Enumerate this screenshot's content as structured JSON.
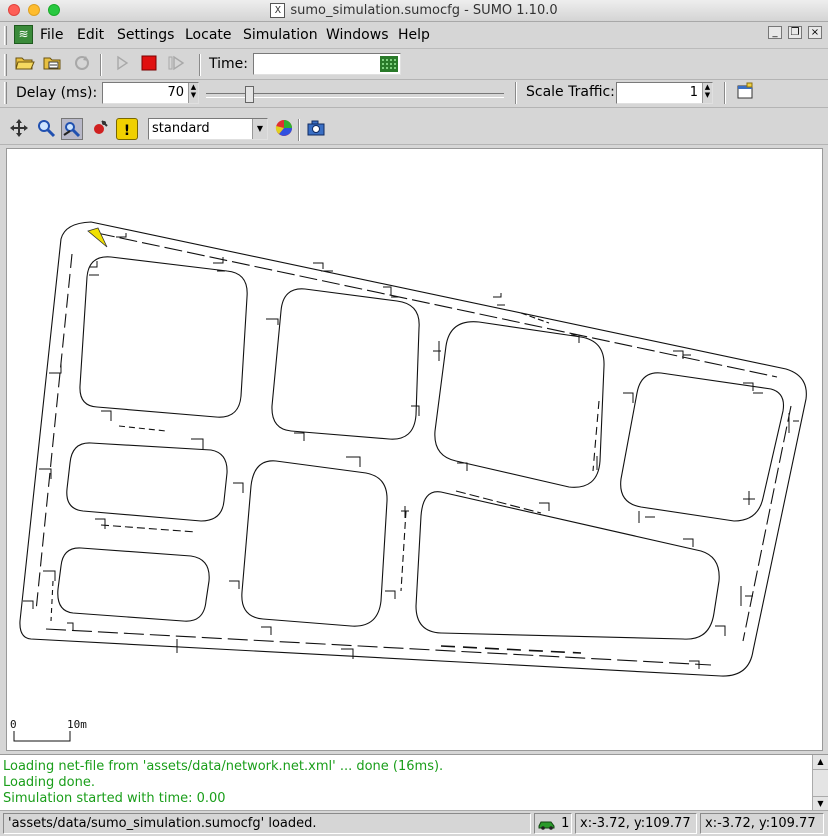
{
  "window": {
    "title": "sumo_simulation.sumocfg - SUMO 1.10.0",
    "x_glyph": "X"
  },
  "menu": {
    "items": [
      "File",
      "Edit",
      "Settings",
      "Locate",
      "Simulation",
      "Windows",
      "Help"
    ]
  },
  "toolbar": {
    "time_label": "Time:",
    "time_value": "",
    "delay_label": "Delay (ms):",
    "delay_value": "70",
    "delay_slider_value": 0.07,
    "scale_label": "Scale Traffic:",
    "scale_value": "1",
    "scheme_value": "standard"
  },
  "view": {
    "scale_zero": "0",
    "scale_length": "10m"
  },
  "log": {
    "lines": [
      "Loading net-file from 'assets/data/network.net.xml' ... done (16ms).",
      "Loading done.",
      "Simulation started with time: 0.00"
    ]
  },
  "status": {
    "message": "'assets/data/sumo_simulation.sumocfg' loaded.",
    "vehicle_count": "1",
    "coords_net": "x:-3.72, y:109.77",
    "coords_geo": "x:-3.72, y:109.77"
  },
  "colors": {
    "log_text": "#1a9e1a",
    "stop_red": "#e01010",
    "vehicle_yellow": "#f0e000"
  }
}
